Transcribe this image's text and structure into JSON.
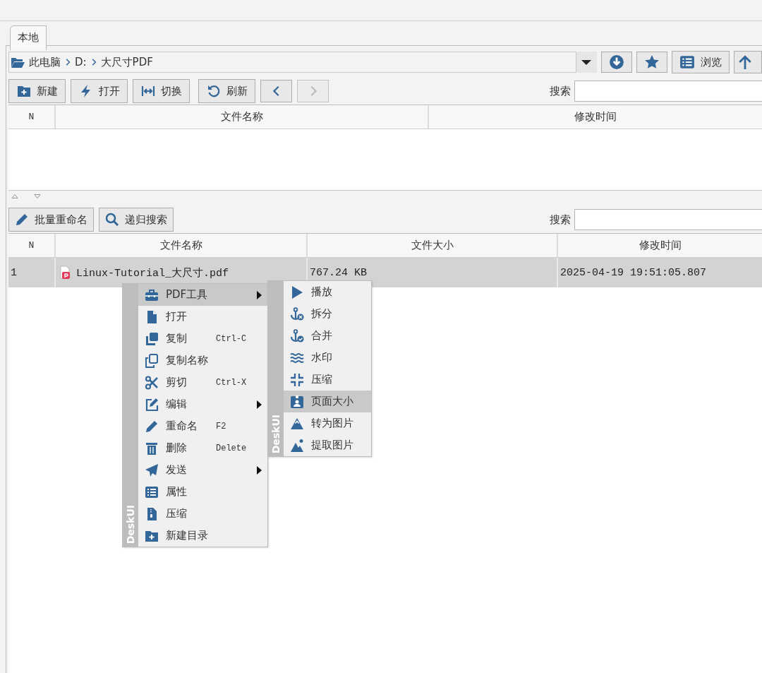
{
  "tabs": [
    {
      "label": "本地",
      "selected": true
    }
  ],
  "path_bar": {
    "segments": [
      "此电脑",
      "D:",
      "大尺寸PDF"
    ]
  },
  "browse_button": {
    "label": "浏览"
  },
  "toolbar": {
    "buttons": [
      {
        "label": "新建"
      },
      {
        "label": "打开"
      },
      {
        "label": "切换"
      },
      {
        "label": "刷新"
      }
    ],
    "back_disabled": false,
    "forward_disabled": true,
    "search_label": "搜索"
  },
  "folder_table": {
    "columns": [
      "N",
      "文件名称",
      "修改时间"
    ]
  },
  "file_toolbar": {
    "buttons": [
      {
        "label": "批量重命名"
      },
      {
        "label": "递归搜索"
      }
    ],
    "search_label": "搜索"
  },
  "file_table": {
    "columns": [
      "N",
      "文件名称",
      "文件大小",
      "修改时间"
    ],
    "rows": [
      {
        "n": "1",
        "name": "Linux-Tutorial_大尺寸.pdf",
        "size": "767.24 KB",
        "modified": "2025-04-19 19:51:05.807",
        "selected": true
      }
    ]
  },
  "context_menu": {
    "brand": "DeskUI",
    "items": [
      {
        "label": "PDF工具",
        "submenu": true,
        "selected": true
      },
      {
        "label": "打开",
        "submenu": false,
        "selected": false
      },
      {
        "label": "复制",
        "shortcut": "Ctrl-C",
        "submenu": false,
        "selected": false
      },
      {
        "label": "复制名称",
        "submenu": false,
        "selected": false
      },
      {
        "label": "剪切",
        "shortcut": "Ctrl-X",
        "submenu": false,
        "selected": false
      },
      {
        "label": "编辑",
        "submenu": true,
        "selected": false
      },
      {
        "label": "重命名",
        "shortcut": "F2",
        "submenu": false,
        "selected": false
      },
      {
        "label": "删除",
        "shortcut": "Delete",
        "submenu": false,
        "selected": false
      },
      {
        "label": "发送",
        "submenu": true,
        "selected": false
      },
      {
        "label": "属性",
        "submenu": false,
        "selected": false
      },
      {
        "label": "压缩",
        "submenu": false,
        "selected": false
      },
      {
        "label": "新建目录",
        "submenu": false,
        "selected": false
      }
    ]
  },
  "submenu": {
    "brand": "DeskUI",
    "items": [
      {
        "label": "播放",
        "selected": false
      },
      {
        "label": "拆分",
        "selected": false
      },
      {
        "label": "合并",
        "selected": false
      },
      {
        "label": "水印",
        "selected": false
      },
      {
        "label": "压缩",
        "selected": false
      },
      {
        "label": "页面大小",
        "selected": true
      },
      {
        "label": "转为图片",
        "selected": false
      },
      {
        "label": "提取图片",
        "selected": false
      }
    ]
  }
}
